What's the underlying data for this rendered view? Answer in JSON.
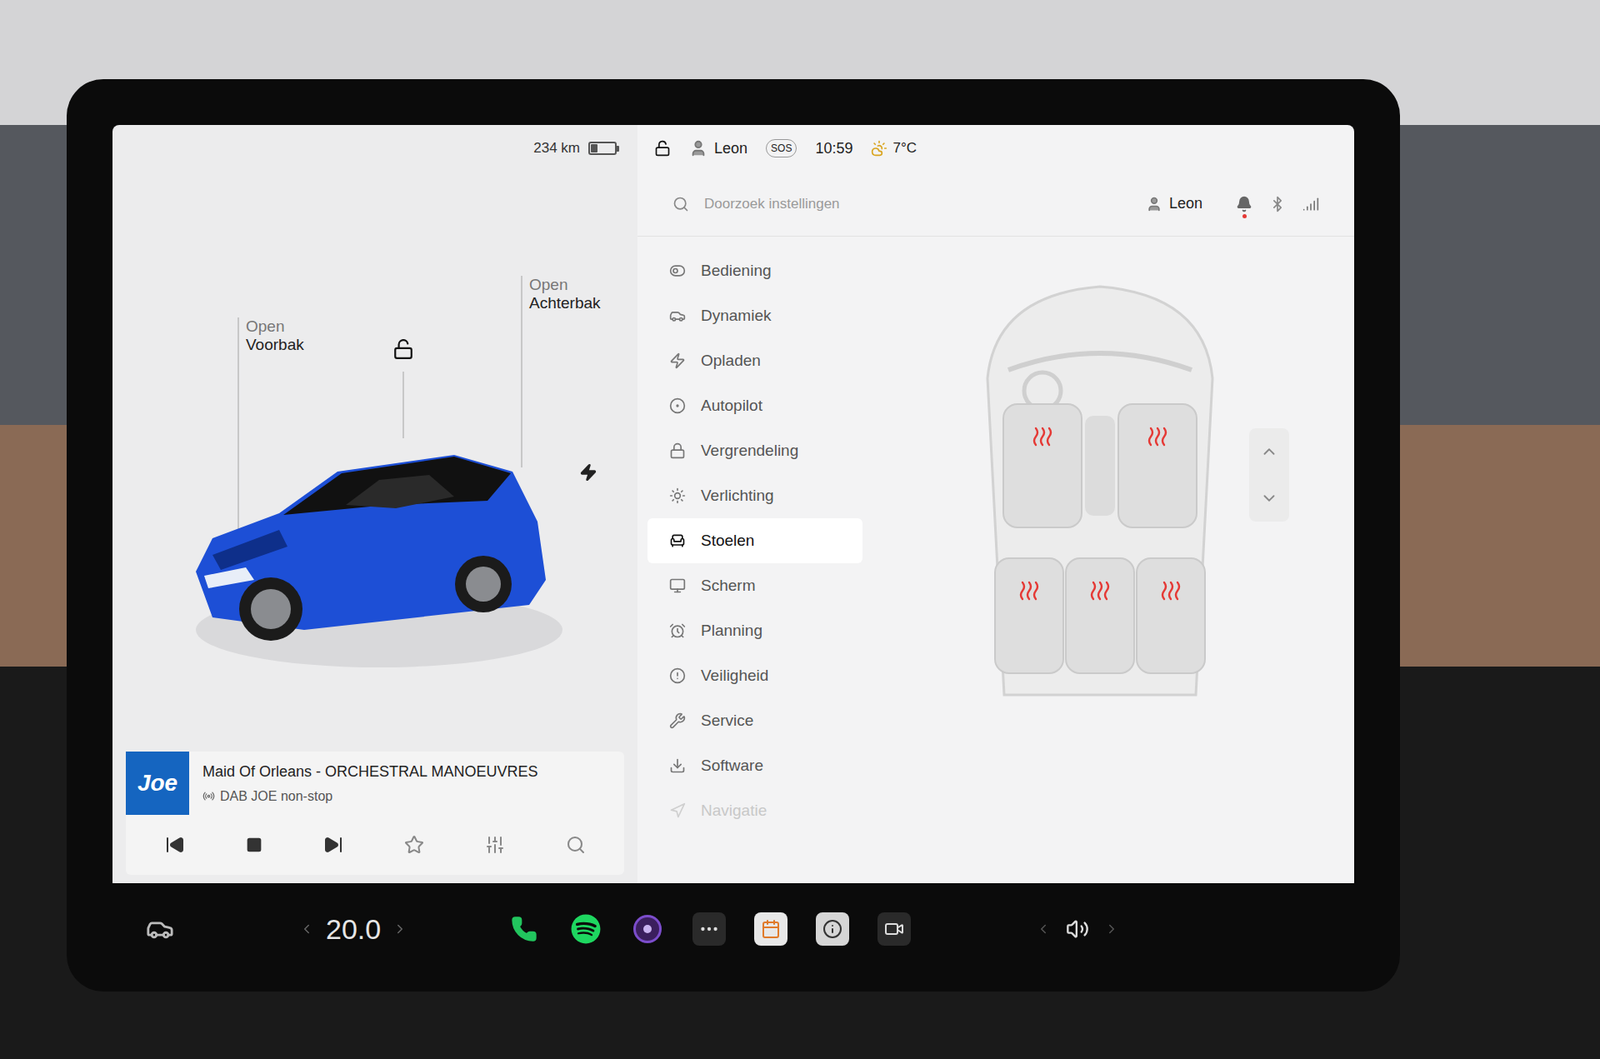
{
  "status_bar": {
    "range": "234 km",
    "battery_level": 0.3,
    "locked": false,
    "user": "Leon",
    "sos": "SOS",
    "time": "10:59",
    "temperature": "7°C"
  },
  "car": {
    "locked": false,
    "color": "#1d4fd6",
    "labels": [
      {
        "top": "Open",
        "bottom": "Voorbak"
      },
      {
        "top": "Open",
        "bottom": "Achterbak"
      }
    ]
  },
  "media": {
    "logo": "Joe",
    "title": "Maid Of Orleans - ORCHESTRAL MANOEUVRES",
    "source": "DAB JOE non-stop",
    "favorite": false
  },
  "settings": {
    "search": {
      "placeholder": "Doorzoek instellingen"
    },
    "profile": "Leon",
    "notification": true,
    "menu": [
      {
        "label": "Bediening",
        "selected": false,
        "faded": false
      },
      {
        "label": "Dynamiek",
        "selected": false,
        "faded": false
      },
      {
        "label": "Opladen",
        "selected": false,
        "faded": false
      },
      {
        "label": "Autopilot",
        "selected": false,
        "faded": false
      },
      {
        "label": "Vergrendeling",
        "selected": false,
        "faded": false
      },
      {
        "label": "Verlichting",
        "selected": false,
        "faded": false
      },
      {
        "label": "Stoelen",
        "selected": true,
        "faded": false
      },
      {
        "label": "Scherm",
        "selected": false,
        "faded": false
      },
      {
        "label": "Planning",
        "selected": false,
        "faded": false
      },
      {
        "label": "Veiligheid",
        "selected": false,
        "faded": false
      },
      {
        "label": "Service",
        "selected": false,
        "faded": false
      },
      {
        "label": "Software",
        "selected": false,
        "faded": false
      },
      {
        "label": "Navigatie",
        "selected": false,
        "faded": true
      }
    ]
  },
  "seats": [
    {
      "heat": 3
    },
    {
      "heat": 3
    },
    {
      "heat": 3
    },
    {
      "heat": 3
    },
    {
      "heat": 3
    }
  ],
  "bottom_bar": {
    "cabin_temperature": "20.0",
    "apps": [
      {
        "kind": "phone"
      },
      {
        "kind": "spotify"
      },
      {
        "kind": "camera"
      },
      {
        "kind": "more"
      },
      {
        "kind": "calendar"
      },
      {
        "kind": "info"
      },
      {
        "kind": "video"
      }
    ]
  }
}
